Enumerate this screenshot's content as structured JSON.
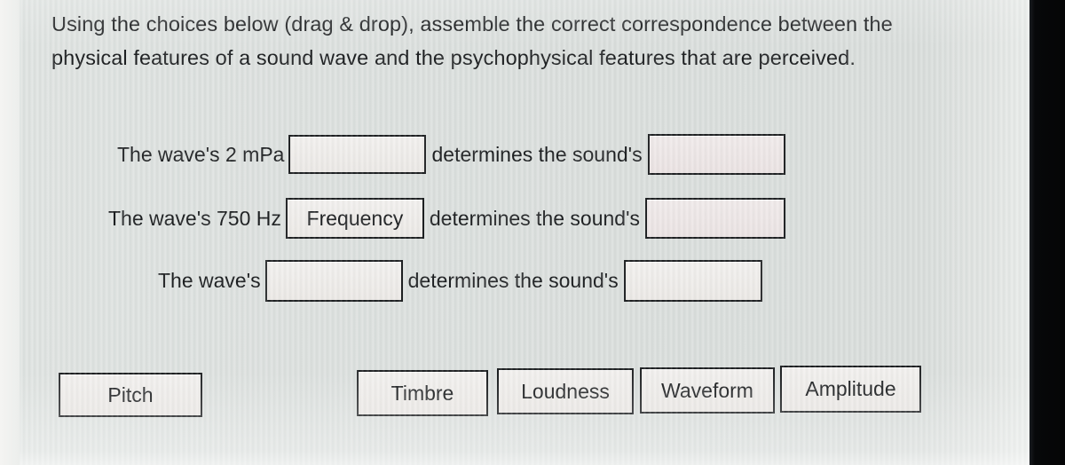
{
  "question": {
    "instructions": "Using the choices below (drag & drop), assemble the correct correspondence between the physical features of a sound wave and the psychophysical features that are perceived.",
    "connector_text": "determines the sound's",
    "subject_prefix": "The wave's",
    "rows": [
      {
        "prefix": "The wave's 2 mPa",
        "answer_physical": "",
        "connector": "determines the sound's",
        "answer_perceptual": ""
      },
      {
        "prefix": "The wave's 750 Hz",
        "answer_physical": "Frequency",
        "connector": "determines the sound's",
        "answer_perceptual": ""
      },
      {
        "prefix": "The wave's",
        "answer_physical": "",
        "connector": "determines the sound's",
        "answer_perceptual": ""
      }
    ]
  },
  "choices": [
    {
      "label": "Pitch"
    },
    {
      "label": "Timbre"
    },
    {
      "label": "Loudness"
    },
    {
      "label": "Waveform"
    },
    {
      "label": "Amplitude"
    }
  ],
  "colors": {
    "background": "#dde1df",
    "text": "#16181a",
    "box_border": "#16181a",
    "box_fill": "#f0ede a",
    "bezel": "#050506"
  }
}
